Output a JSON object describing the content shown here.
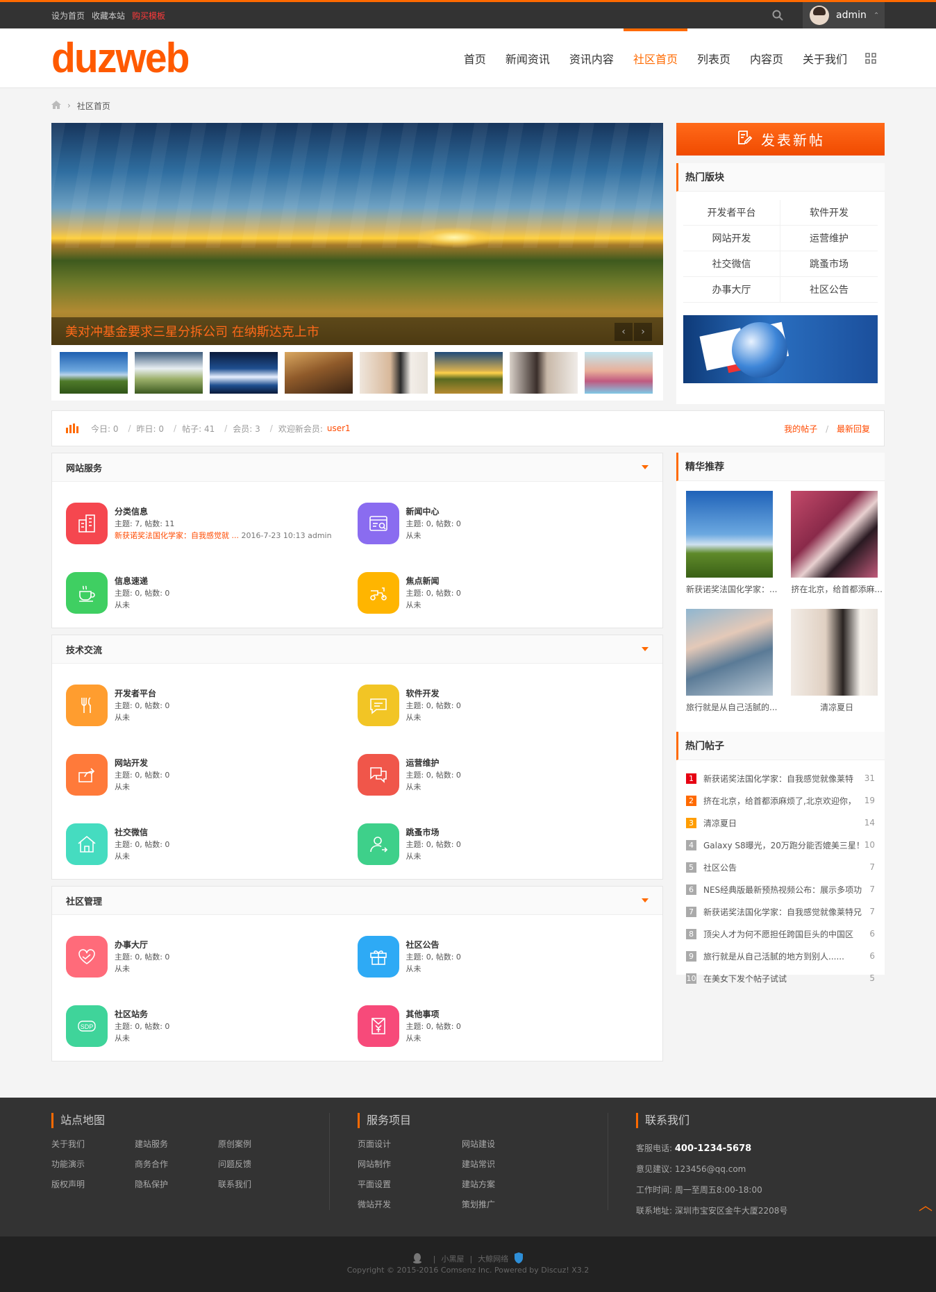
{
  "topbar": {
    "links": [
      "设为首页",
      "收藏本站",
      "购买模板"
    ],
    "username": "admin"
  },
  "header": {
    "logo": "duzweb",
    "nav": [
      "首页",
      "新闻资讯",
      "资讯内容",
      "社区首页",
      "列表页",
      "内容页",
      "关于我们"
    ],
    "active_nav": "社区首页"
  },
  "breadcrumb": {
    "current": "社区首页"
  },
  "slider": {
    "caption": "美对冲基金要求三星分拆公司 在纳斯达克上市"
  },
  "sidebar": {
    "post_button": "发表新帖",
    "hot_boards_title": "热门版块",
    "hot_boards": [
      "开发者平台",
      "软件开发",
      "网站开发",
      "运营维护",
      "社交微信",
      "跳蚤市场",
      "办事大厅",
      "社区公告"
    ],
    "jinghua_title": "精华推荐",
    "jinghua": [
      "新获诺奖法国化学家：...",
      "挤在北京，给首都添麻...",
      "旅行就是从自己活腻的...",
      "清凉夏日"
    ],
    "hot_posts_title": "热门帖子",
    "hot_posts": [
      {
        "n": "1",
        "title": "新获诺奖法国化学家：自我感觉就像莱特",
        "count": "31",
        "color": "#e60012"
      },
      {
        "n": "2",
        "title": "挤在北京，给首都添麻烦了,北京欢迎你，",
        "count": "19",
        "color": "#ff6a00"
      },
      {
        "n": "3",
        "title": "清凉夏日",
        "count": "14",
        "color": "#ff9d00"
      },
      {
        "n": "4",
        "title": "Galaxy S8曝光，20万跑分能否媲美三星！",
        "count": "10",
        "color": "#aaaaaa"
      },
      {
        "n": "5",
        "title": "社区公告",
        "count": "7",
        "color": "#aaaaaa"
      },
      {
        "n": "6",
        "title": "NES经典版最新预热视频公布：展示多项功",
        "count": "7",
        "color": "#aaaaaa"
      },
      {
        "n": "7",
        "title": "新获诺奖法国化学家：自我感觉就像莱特兄",
        "count": "7",
        "color": "#aaaaaa"
      },
      {
        "n": "8",
        "title": "顶尖人才为何不愿担任跨国巨头的中国区",
        "count": "6",
        "color": "#aaaaaa"
      },
      {
        "n": "9",
        "title": "旅行就是从自己活腻的地方到别人......",
        "count": "6",
        "color": "#aaaaaa"
      },
      {
        "n": "10",
        "title": "在美女下发个帖子试试",
        "count": "5",
        "color": "#aaaaaa"
      }
    ]
  },
  "stats": {
    "today": "今日: 0",
    "yesterday": "昨日: 0",
    "posts": "帖子: 41",
    "members": "会员: 3",
    "welcome": "欢迎新会员: ",
    "new_member": "user1",
    "my_posts": "我的帖子",
    "latest": "最新回复"
  },
  "categories": [
    {
      "title": "网站服务",
      "forums": [
        {
          "name": "分类信息",
          "stat": "主题: 7, 帖数: 11",
          "last": "新获诺奖法国化学家：自我感觉就 ...",
          "time": "2016-7-23 10:13 admin",
          "color": "#f5474f",
          "icon": "building-icon"
        },
        {
          "name": "新闻中心",
          "stat": "主题: 0, 帖数: 0",
          "last": "从未",
          "time": "",
          "color": "#8a6cf0",
          "icon": "browser-icon"
        },
        {
          "name": "信息速递",
          "stat": "主题: 0, 帖数: 0",
          "last": "从未",
          "time": "",
          "color": "#3fcf62",
          "icon": "coffee-icon"
        },
        {
          "name": "焦点新闻",
          "stat": "主题: 0, 帖数: 0",
          "last": "从未",
          "time": "",
          "color": "#ffb500",
          "icon": "scooter-icon"
        }
      ]
    },
    {
      "title": "技术交流",
      "forums": [
        {
          "name": "开发者平台",
          "stat": "主题: 0, 帖数: 0",
          "last": "从未",
          "time": "",
          "color": "#ff9d2f",
          "icon": "utensils-icon"
        },
        {
          "name": "软件开发",
          "stat": "主题: 0, 帖数: 0",
          "last": "从未",
          "time": "",
          "color": "#f2c525",
          "icon": "chat-icon"
        },
        {
          "name": "网站开发",
          "stat": "主题: 0, 帖数: 0",
          "last": "从未",
          "time": "",
          "color": "#ff7a3a",
          "icon": "share-icon"
        },
        {
          "name": "运营维护",
          "stat": "主题: 0, 帖数: 0",
          "last": "从未",
          "time": "",
          "color": "#f0564a",
          "icon": "messages-icon"
        },
        {
          "name": "社交微信",
          "stat": "主题: 0, 帖数: 0",
          "last": "从未",
          "time": "",
          "color": "#45dcc0",
          "icon": "home-icon"
        },
        {
          "name": "跳蚤市场",
          "stat": "主题: 0, 帖数: 0",
          "last": "从未",
          "time": "",
          "color": "#3ed08a",
          "icon": "user-icon"
        }
      ]
    },
    {
      "title": "社区管理",
      "forums": [
        {
          "name": "办事大厅",
          "stat": "主题: 0, 帖数: 0",
          "last": "从未",
          "time": "",
          "color": "#ff6b7a",
          "icon": "heart-icon"
        },
        {
          "name": "社区公告",
          "stat": "主题: 0, 帖数: 0",
          "last": "从未",
          "time": "",
          "color": "#2eaaf5",
          "icon": "gift-icon"
        },
        {
          "name": "社区站务",
          "stat": "主题: 0, 帖数: 0",
          "last": "从未",
          "time": "",
          "color": "#3fd49a",
          "icon": "sdp-icon"
        },
        {
          "name": "其他事项",
          "stat": "主题: 0, 帖数: 0",
          "last": "从未",
          "time": "",
          "color": "#f74a7a",
          "icon": "envelope-icon"
        }
      ]
    }
  ],
  "footer": {
    "sitemap_title": "站点地图",
    "sitemap": [
      "关于我们",
      "建站服务",
      "原创案例",
      "功能演示",
      "商务合作",
      "问题反馈",
      "版权声明",
      "隐私保护",
      "联系我们"
    ],
    "services_title": "服务项目",
    "services": [
      "页面设计",
      "网站建设",
      "网站制作",
      "建站常识",
      "平面设置",
      "建站方案",
      "微站开发",
      "策划推广"
    ],
    "contact_title": "联系我们",
    "phone_label": "客服电话:",
    "phone": "400-1234-5678",
    "email": "意见建议: 123456@qq.com",
    "hours": "工作时间: 周一至周五8:00-18:00",
    "address": "联系地址: 深圳市宝安区金牛大厦2208号",
    "bottom_links": [
      "小黑屋",
      "大鲸网络"
    ],
    "copyright": "Copyright © 2015-2016 Comsenz Inc.   Powered by Discuz! X3.2"
  }
}
